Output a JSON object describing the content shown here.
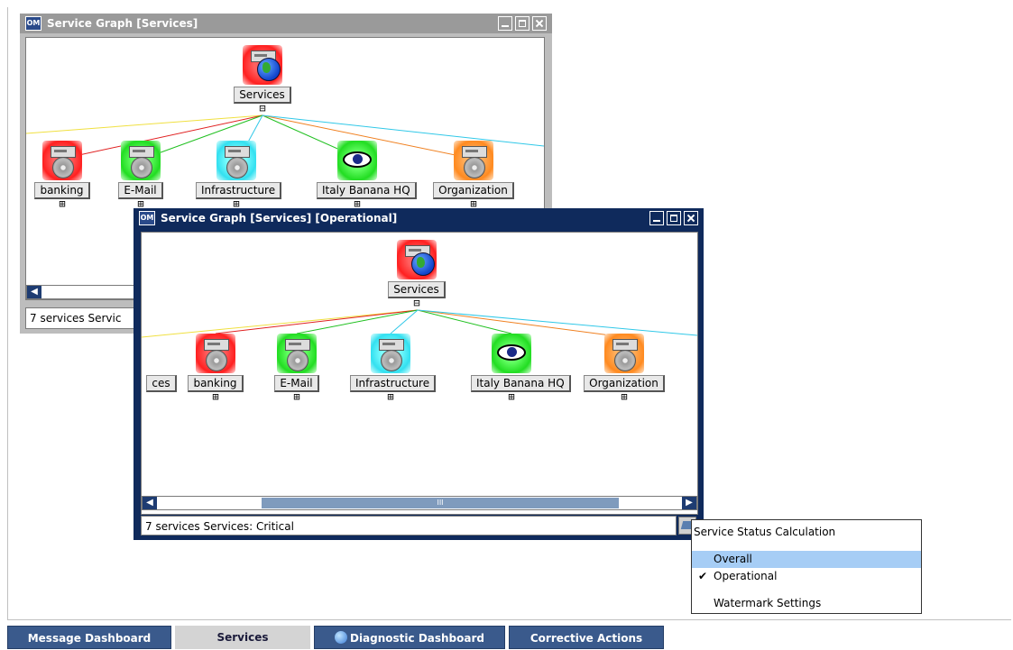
{
  "back_window": {
    "title": "Service Graph [Services]",
    "logo_text": "OM",
    "status": "7 services  Servic",
    "nodes": [
      {
        "label": "Services",
        "color": "red",
        "icon": "globe-server-icon"
      },
      {
        "label": "banking",
        "color": "red",
        "icon": "server-icon"
      },
      {
        "label": "E-Mail",
        "color": "green",
        "icon": "server-icon"
      },
      {
        "label": "Infrastructure",
        "color": "cyan",
        "icon": "server-icon"
      },
      {
        "label": "Italy Banana HQ",
        "color": "green",
        "icon": "eye-icon"
      },
      {
        "label": "Organization",
        "color": "orange",
        "icon": "server-icon"
      }
    ]
  },
  "front_window": {
    "title": "Service Graph [Services] [Operational]",
    "logo_text": "OM",
    "status": "7 services  Services: Critical",
    "scroll_thumb": "III",
    "nodes": [
      {
        "label": "Services",
        "color": "red",
        "icon": "globe-server-icon"
      },
      {
        "label": "ces",
        "color": "none",
        "icon": "none"
      },
      {
        "label": "banking",
        "color": "red",
        "icon": "server-icon"
      },
      {
        "label": "E-Mail",
        "color": "green",
        "icon": "server-icon"
      },
      {
        "label": "Infrastructure",
        "color": "cyan",
        "icon": "server-icon"
      },
      {
        "label": "Italy Banana HQ",
        "color": "green",
        "icon": "eye-icon"
      },
      {
        "label": "Organization",
        "color": "orange",
        "icon": "server-icon"
      }
    ]
  },
  "context_menu": {
    "header": "Service Status Calculation",
    "items": [
      {
        "label": "Overall",
        "checked": false,
        "highlighted": true
      },
      {
        "label": "Operational",
        "checked": true,
        "highlighted": false
      },
      {
        "label": "Watermark Settings",
        "checked": false,
        "highlighted": false
      }
    ]
  },
  "tabs": [
    {
      "label": "Message Dashboard",
      "selected": false
    },
    {
      "label": "Services",
      "selected": true
    },
    {
      "label": "Diagnostic Dashboard",
      "selected": false
    },
    {
      "label": "Corrective Actions",
      "selected": false
    }
  ],
  "colors": {
    "active_title": "#0f2a5c",
    "inactive_title": "#9a9a9a",
    "tab_blue": "#3a5a8c",
    "menu_highlight": "#a6cdf5",
    "edge_yellow": "#f0e040",
    "edge_red": "#e02020",
    "edge_green": "#20c020",
    "edge_cyan": "#30c8e8",
    "edge_orange": "#f08020"
  }
}
